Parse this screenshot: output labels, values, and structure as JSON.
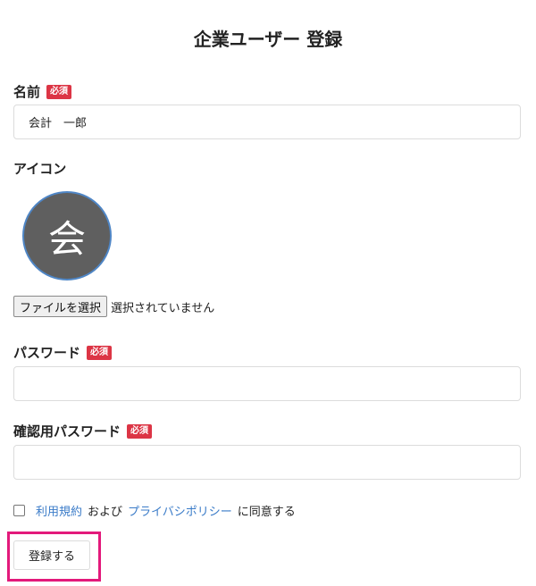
{
  "page": {
    "title": "企業ユーザー 登録"
  },
  "required_badge": "必須",
  "form": {
    "name": {
      "label": "名前",
      "value": "会計　一郎"
    },
    "icon": {
      "label": "アイコン",
      "avatar_text": "会"
    },
    "file": {
      "button_label": "ファイルを選択",
      "status": "選択されていません"
    },
    "password": {
      "label": "パスワード",
      "value": ""
    },
    "password_confirm": {
      "label": "確認用パスワード",
      "value": ""
    },
    "agreement": {
      "terms_link": "利用規約",
      "and_text": "および",
      "privacy_link": "プライバシポリシー",
      "suffix_text": "に同意する"
    },
    "submit_label": "登録する"
  },
  "colors": {
    "badge": "#dc3545",
    "link": "#3a7bc8",
    "highlight": "#e3197b",
    "avatar_bg": "#5f5f5f",
    "avatar_border": "#4f86c6"
  }
}
